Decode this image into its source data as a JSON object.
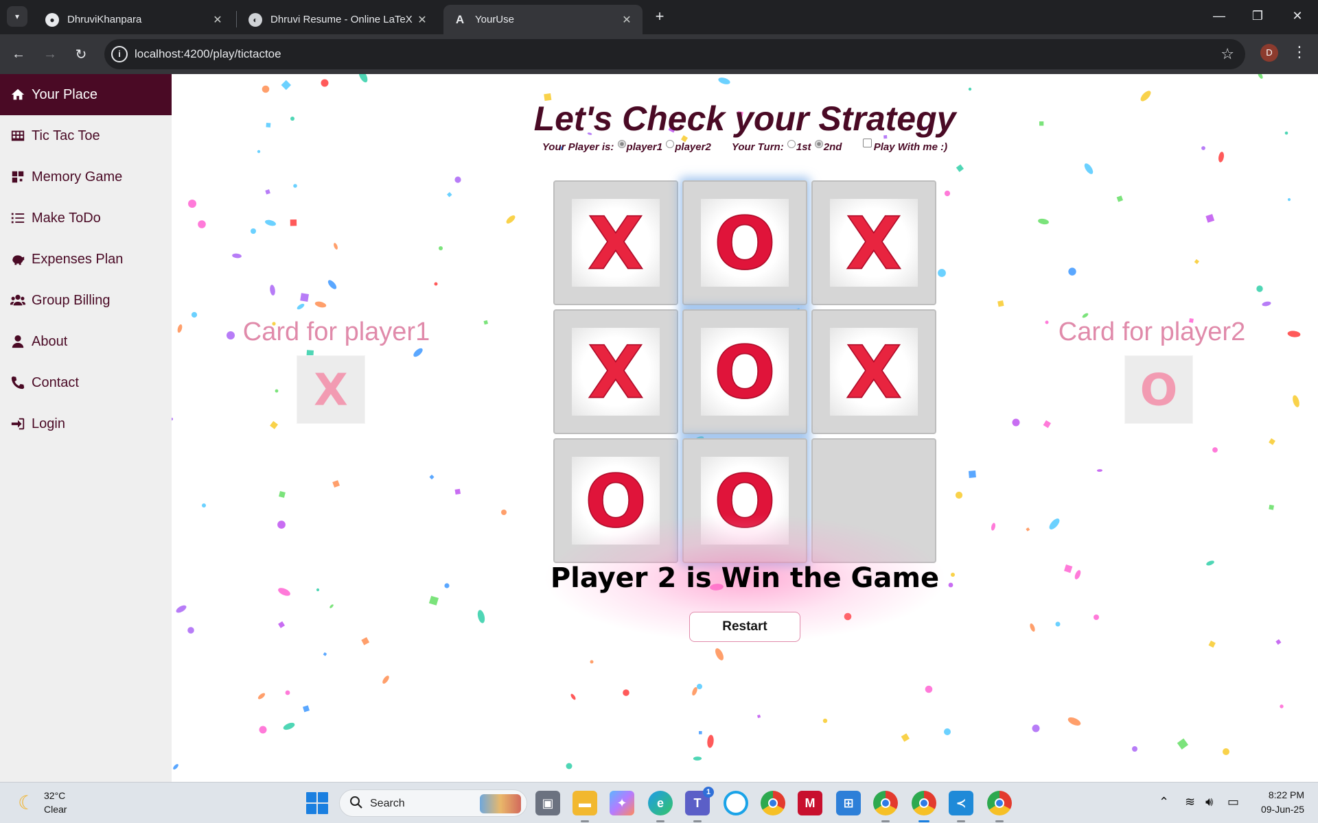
{
  "browser": {
    "tabs": [
      {
        "title": "DhruviKhanpara",
        "favicon": "github-icon"
      },
      {
        "title": "Dhruvi Resume - Online LaTeX E",
        "favicon": "overleaf-icon"
      },
      {
        "title": "YourUse",
        "favicon": "angular-icon"
      }
    ],
    "active_tab": 2,
    "url": "localhost:4200/play/tictactoe",
    "profile_initial": "D"
  },
  "sidebar": {
    "items": [
      {
        "label": "Your Place",
        "icon": "home-icon"
      },
      {
        "label": "Tic Tac Toe",
        "icon": "grid-icon"
      },
      {
        "label": "Memory Game",
        "icon": "puzzle-icon"
      },
      {
        "label": "Make ToDo",
        "icon": "list-icon"
      },
      {
        "label": "Expenses Plan",
        "icon": "piggy-bank-icon"
      },
      {
        "label": "Group Billing",
        "icon": "users-icon"
      },
      {
        "label": "About",
        "icon": "user-icon"
      },
      {
        "label": "Contact",
        "icon": "phone-icon"
      },
      {
        "label": "Login",
        "icon": "sign-in-icon"
      }
    ]
  },
  "game": {
    "title": "Let's Check your Strategy",
    "player_label": "Your Player is:",
    "player_options": [
      "player1",
      "player2"
    ],
    "player_selected": "player1",
    "turn_label": "Your Turn:",
    "turn_options": [
      "1st",
      "2nd"
    ],
    "turn_selected": "2nd",
    "play_with_me_label": "Play With me :)",
    "play_with_me_checked": false,
    "player1_card_title": "Card for player1",
    "player1_symbol": "X",
    "player2_card_title": "Card for player2",
    "player2_symbol": "O",
    "board": [
      "X",
      "O",
      "X",
      "X",
      "O",
      "X",
      "O",
      "O",
      ""
    ],
    "winning_cells": [
      1,
      4,
      7
    ],
    "result_text": "Player 2 is Win the Game",
    "restart_label": "Restart"
  },
  "taskbar": {
    "weather_temp": "32°C",
    "weather_cond": "Clear",
    "search_placeholder": "Search",
    "teams_badge": "1",
    "time": "8:22 PM",
    "date": "09-Jun-25"
  },
  "colors": {
    "brand": "#4a0a25",
    "x_mark": "#e8243f",
    "o_mark": "#e0143a",
    "card_title": "#e08aaa"
  }
}
